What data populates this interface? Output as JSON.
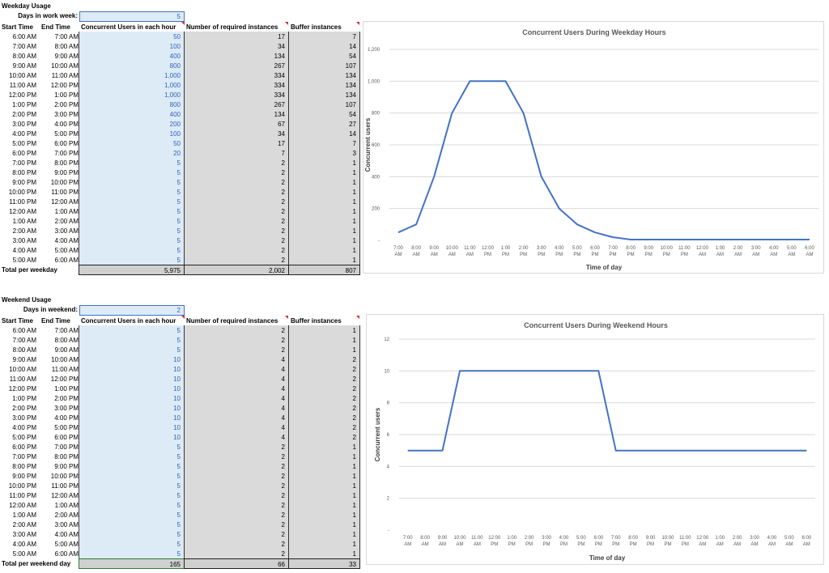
{
  "weekday": {
    "title": "Weekday Usage",
    "days_label": "Days in work week:",
    "days_value": "5",
    "headers": {
      "start": "Start Time",
      "end": "End Time",
      "users": "Concurrent Users in each hour",
      "required": "Number of required instances",
      "buffer": "Buffer instances"
    },
    "rows": [
      {
        "start": "6:00 AM",
        "end": "7:00 AM",
        "users": "50",
        "required": "17",
        "buffer": "7"
      },
      {
        "start": "7:00 AM",
        "end": "8:00 AM",
        "users": "100",
        "required": "34",
        "buffer": "14"
      },
      {
        "start": "8:00 AM",
        "end": "9:00 AM",
        "users": "400",
        "required": "134",
        "buffer": "54"
      },
      {
        "start": "9:00 AM",
        "end": "10:00 AM",
        "users": "800",
        "required": "267",
        "buffer": "107"
      },
      {
        "start": "10:00 AM",
        "end": "11:00 AM",
        "users": "1,000",
        "required": "334",
        "buffer": "134"
      },
      {
        "start": "11:00 AM",
        "end": "12:00 PM",
        "users": "1,000",
        "required": "334",
        "buffer": "134"
      },
      {
        "start": "12:00 PM",
        "end": "1:00 PM",
        "users": "1,000",
        "required": "334",
        "buffer": "134"
      },
      {
        "start": "1:00 PM",
        "end": "2:00 PM",
        "users": "800",
        "required": "267",
        "buffer": "107"
      },
      {
        "start": "2:00 PM",
        "end": "3:00 PM",
        "users": "400",
        "required": "134",
        "buffer": "54"
      },
      {
        "start": "3:00 PM",
        "end": "4:00 PM",
        "users": "200",
        "required": "67",
        "buffer": "27"
      },
      {
        "start": "4:00 PM",
        "end": "5:00 PM",
        "users": "100",
        "required": "34",
        "buffer": "14"
      },
      {
        "start": "5:00 PM",
        "end": "6:00 PM",
        "users": "50",
        "required": "17",
        "buffer": "7"
      },
      {
        "start": "6:00 PM",
        "end": "7:00 PM",
        "users": "20",
        "required": "7",
        "buffer": "3"
      },
      {
        "start": "7:00 PM",
        "end": "8:00 PM",
        "users": "5",
        "required": "2",
        "buffer": "1"
      },
      {
        "start": "8:00 PM",
        "end": "9:00 PM",
        "users": "5",
        "required": "2",
        "buffer": "1"
      },
      {
        "start": "9:00 PM",
        "end": "10:00 PM",
        "users": "5",
        "required": "2",
        "buffer": "1"
      },
      {
        "start": "10:00 PM",
        "end": "11:00 PM",
        "users": "5",
        "required": "2",
        "buffer": "1"
      },
      {
        "start": "11:00 PM",
        "end": "12:00 AM",
        "users": "5",
        "required": "2",
        "buffer": "1"
      },
      {
        "start": "12:00 AM",
        "end": "1:00 AM",
        "users": "5",
        "required": "2",
        "buffer": "1"
      },
      {
        "start": "1:00 AM",
        "end": "2:00 AM",
        "users": "5",
        "required": "2",
        "buffer": "1"
      },
      {
        "start": "2:00 AM",
        "end": "3:00 AM",
        "users": "5",
        "required": "2",
        "buffer": "1"
      },
      {
        "start": "3:00 AM",
        "end": "4:00 AM",
        "users": "5",
        "required": "2",
        "buffer": "1"
      },
      {
        "start": "4:00 AM",
        "end": "5:00 AM",
        "users": "5",
        "required": "2",
        "buffer": "1"
      },
      {
        "start": "5:00 AM",
        "end": "6:00 AM",
        "users": "5",
        "required": "2",
        "buffer": "1"
      }
    ],
    "total": {
      "label": "Total per weekday",
      "users": "5,975",
      "required": "2,002",
      "buffer": "807"
    }
  },
  "weekend": {
    "title": "Weekend Usage",
    "days_label": "Days in weekend:",
    "days_value": "2",
    "headers": {
      "start": "Start Time",
      "end": "End Time",
      "users": "Concurrent Users in each hour",
      "required": "Number of required instances",
      "buffer": "Buffer instances"
    },
    "rows": [
      {
        "start": "6:00 AM",
        "end": "7:00 AM",
        "users": "5",
        "required": "2",
        "buffer": "1"
      },
      {
        "start": "7:00 AM",
        "end": "8:00 AM",
        "users": "5",
        "required": "2",
        "buffer": "1"
      },
      {
        "start": "8:00 AM",
        "end": "9:00 AM",
        "users": "5",
        "required": "2",
        "buffer": "1"
      },
      {
        "start": "9:00 AM",
        "end": "10:00 AM",
        "users": "10",
        "required": "4",
        "buffer": "2"
      },
      {
        "start": "10:00 AM",
        "end": "11:00 AM",
        "users": "10",
        "required": "4",
        "buffer": "2"
      },
      {
        "start": "11:00 AM",
        "end": "12:00 PM",
        "users": "10",
        "required": "4",
        "buffer": "2"
      },
      {
        "start": "12:00 PM",
        "end": "1:00 PM",
        "users": "10",
        "required": "4",
        "buffer": "2"
      },
      {
        "start": "1:00 PM",
        "end": "2:00 PM",
        "users": "10",
        "required": "4",
        "buffer": "2"
      },
      {
        "start": "2:00 PM",
        "end": "3:00 PM",
        "users": "10",
        "required": "4",
        "buffer": "2"
      },
      {
        "start": "3:00 PM",
        "end": "4:00 PM",
        "users": "10",
        "required": "4",
        "buffer": "2"
      },
      {
        "start": "4:00 PM",
        "end": "5:00 PM",
        "users": "10",
        "required": "4",
        "buffer": "2"
      },
      {
        "start": "5:00 PM",
        "end": "6:00 PM",
        "users": "10",
        "required": "4",
        "buffer": "2"
      },
      {
        "start": "6:00 PM",
        "end": "7:00 PM",
        "users": "5",
        "required": "2",
        "buffer": "1"
      },
      {
        "start": "7:00 PM",
        "end": "8:00 PM",
        "users": "5",
        "required": "2",
        "buffer": "1"
      },
      {
        "start": "8:00 PM",
        "end": "9:00 PM",
        "users": "5",
        "required": "2",
        "buffer": "1"
      },
      {
        "start": "9:00 PM",
        "end": "10:00 PM",
        "users": "5",
        "required": "2",
        "buffer": "1"
      },
      {
        "start": "10:00 PM",
        "end": "11:00 PM",
        "users": "5",
        "required": "2",
        "buffer": "1"
      },
      {
        "start": "11:00 PM",
        "end": "12:00 AM",
        "users": "5",
        "required": "2",
        "buffer": "1"
      },
      {
        "start": "12:00 AM",
        "end": "1:00 AM",
        "users": "5",
        "required": "2",
        "buffer": "1"
      },
      {
        "start": "1:00 AM",
        "end": "2:00 AM",
        "users": "5",
        "required": "2",
        "buffer": "1"
      },
      {
        "start": "2:00 AM",
        "end": "3:00 AM",
        "users": "5",
        "required": "2",
        "buffer": "1"
      },
      {
        "start": "3:00 AM",
        "end": "4:00 AM",
        "users": "5",
        "required": "2",
        "buffer": "1"
      },
      {
        "start": "4:00 AM",
        "end": "5:00 AM",
        "users": "5",
        "required": "2",
        "buffer": "1"
      },
      {
        "start": "5:00 AM",
        "end": "6:00 AM",
        "users": "5",
        "required": "2",
        "buffer": "1"
      }
    ],
    "total": {
      "label": "Total per weekend day",
      "users": "165",
      "required": "66",
      "buffer": "33"
    }
  },
  "colors": {
    "line": "#4472c4",
    "user_cells_bg": "#ddebf7",
    "user_text": "#2e63b8",
    "computed_bg": "#dadada",
    "comment_marker": "#e0282a",
    "weekend_total_border": "#2e7d32"
  },
  "chart_data": [
    {
      "type": "line",
      "title": "Concurrent Users During Weekday Hours",
      "xlabel": "Time of day",
      "ylabel": "Concurrent users",
      "ylim": [
        0,
        1200
      ],
      "yticks": [
        "-",
        "200",
        "400",
        "600",
        "800",
        "1,000",
        "1,200"
      ],
      "grid": true,
      "categories": [
        [
          "7:00",
          "AM"
        ],
        [
          "8:00",
          "AM"
        ],
        [
          "9:00",
          "AM"
        ],
        [
          "10:00",
          "AM"
        ],
        [
          "11:00",
          "AM"
        ],
        [
          "12:00",
          "PM"
        ],
        [
          "1:00",
          "PM"
        ],
        [
          "2:00",
          "PM"
        ],
        [
          "3:00",
          "PM"
        ],
        [
          "4:00",
          "PM"
        ],
        [
          "5:00",
          "PM"
        ],
        [
          "6:00",
          "PM"
        ],
        [
          "7:00",
          "PM"
        ],
        [
          "8:00",
          "PM"
        ],
        [
          "9:00",
          "PM"
        ],
        [
          "10:00",
          "PM"
        ],
        [
          "11:00",
          "PM"
        ],
        [
          "12:00",
          "AM"
        ],
        [
          "1:00",
          "AM"
        ],
        [
          "2:00",
          "AM"
        ],
        [
          "3:00",
          "AM"
        ],
        [
          "4:00",
          "AM"
        ],
        [
          "5:00",
          "AM"
        ],
        [
          "6:00",
          "AM"
        ]
      ],
      "values": [
        50,
        100,
        400,
        800,
        1000,
        1000,
        1000,
        800,
        400,
        200,
        100,
        50,
        20,
        5,
        5,
        5,
        5,
        5,
        5,
        5,
        5,
        5,
        5,
        5
      ]
    },
    {
      "type": "line",
      "title": "Concurrent Users During Weekend Hours",
      "xlabel": "Time of day",
      "ylabel": "Concurrent users",
      "ylim": [
        0,
        12
      ],
      "yticks": [
        "-",
        "2",
        "4",
        "6",
        "8",
        "10",
        "12"
      ],
      "grid": true,
      "categories": [
        [
          "7:00",
          "AM"
        ],
        [
          "8:00",
          "AM"
        ],
        [
          "9:00",
          "AM"
        ],
        [
          "10:00",
          "AM"
        ],
        [
          "11:00",
          "AM"
        ],
        [
          "12:00",
          "PM"
        ],
        [
          "1:00",
          "PM"
        ],
        [
          "2:00",
          "PM"
        ],
        [
          "3:00",
          "PM"
        ],
        [
          "4:00",
          "PM"
        ],
        [
          "5:00",
          "PM"
        ],
        [
          "6:00",
          "PM"
        ],
        [
          "7:00",
          "PM"
        ],
        [
          "8:00",
          "PM"
        ],
        [
          "9:00",
          "PM"
        ],
        [
          "10:00",
          "PM"
        ],
        [
          "11:00",
          "PM"
        ],
        [
          "12:00",
          "AM"
        ],
        [
          "1:00",
          "AM"
        ],
        [
          "2:00",
          "AM"
        ],
        [
          "3:00",
          "AM"
        ],
        [
          "4:00",
          "AM"
        ],
        [
          "5:00",
          "AM"
        ],
        [
          "6:00",
          "AM"
        ]
      ],
      "values": [
        5,
        5,
        5,
        10,
        10,
        10,
        10,
        10,
        10,
        10,
        10,
        10,
        5,
        5,
        5,
        5,
        5,
        5,
        5,
        5,
        5,
        5,
        5,
        5
      ]
    }
  ]
}
